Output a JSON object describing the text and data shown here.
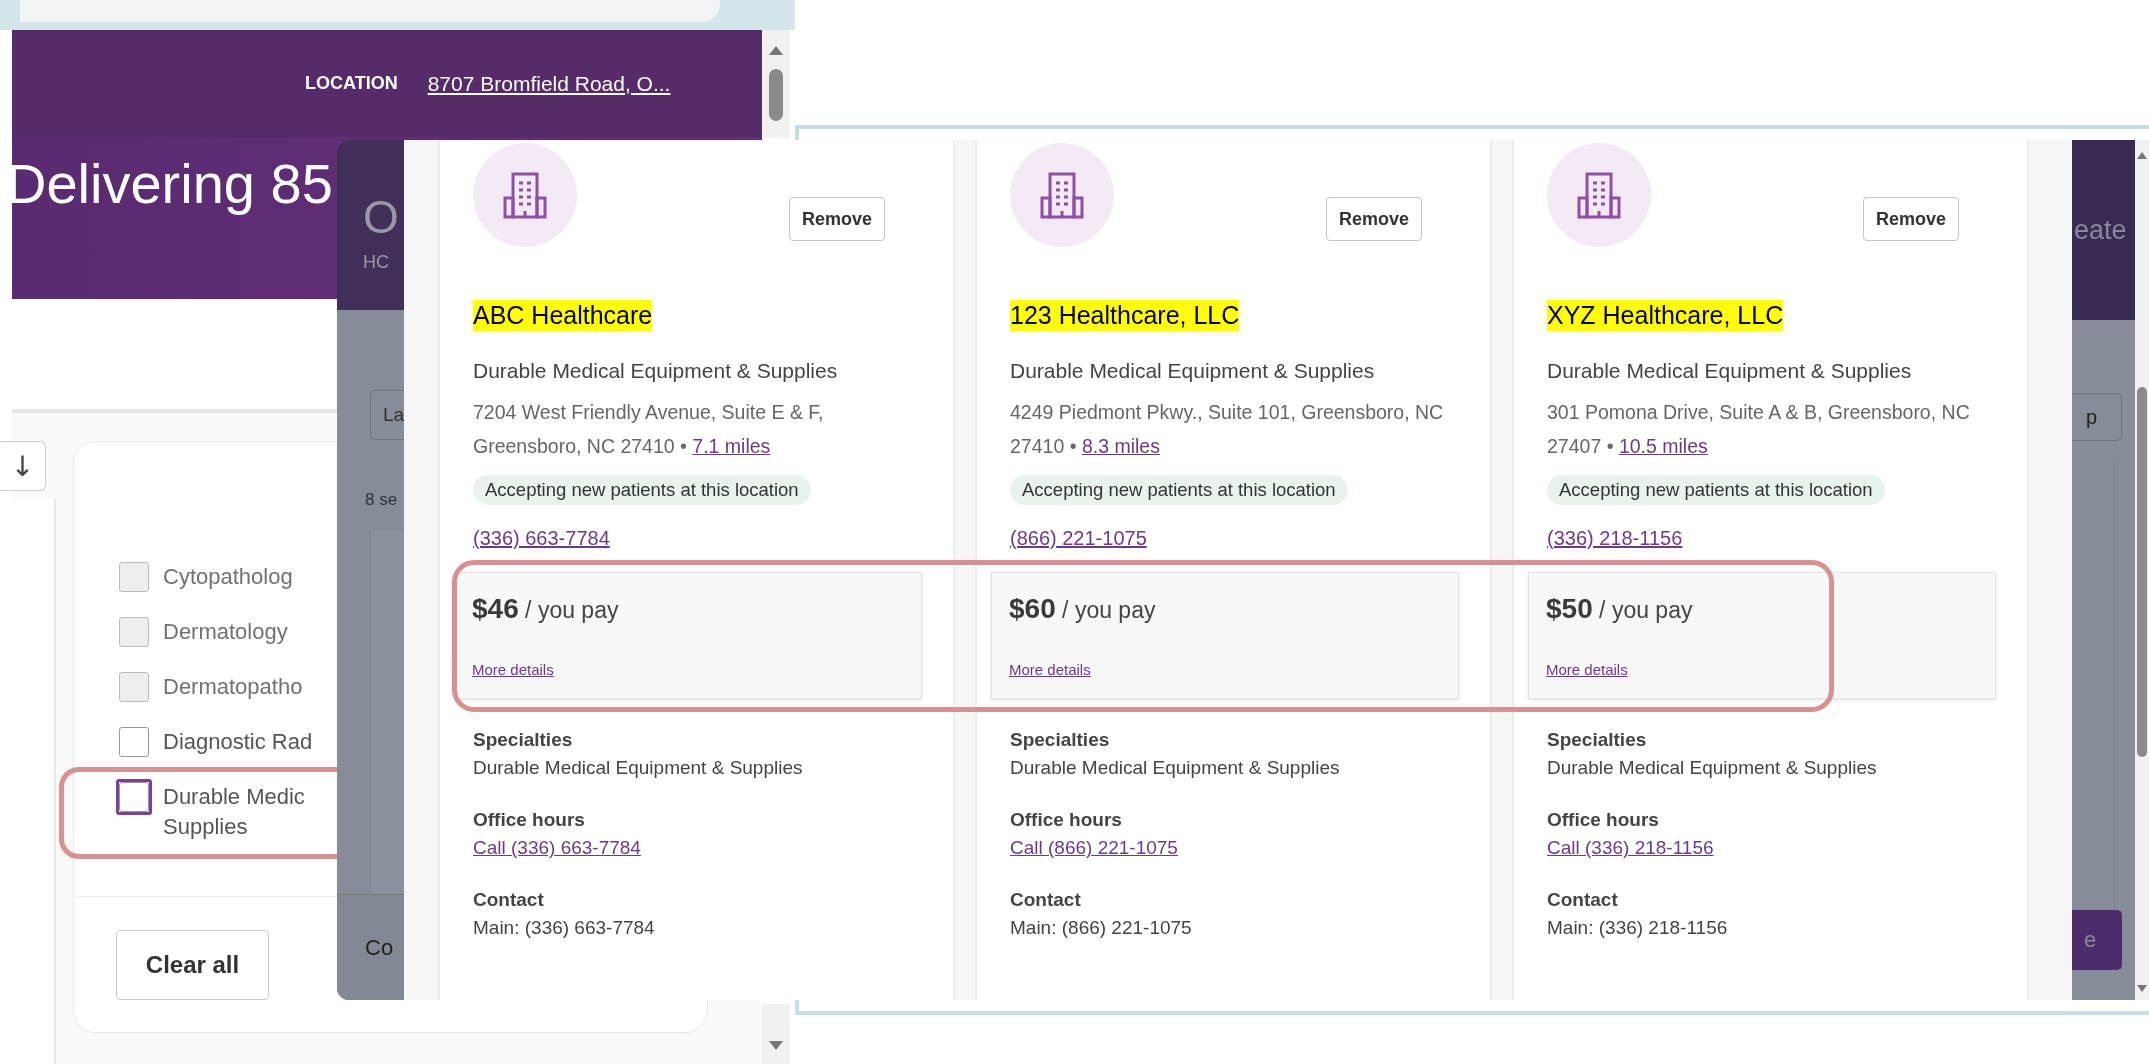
{
  "back_page": {
    "location_label": "LOCATION",
    "location": "8707 Bromfield Road, O...",
    "hero_title": "Delivering 85",
    "sort_button": "↓",
    "filters": [
      {
        "label": "Cytopatholog",
        "disabled": true,
        "focused": false
      },
      {
        "label": "Dermatology",
        "disabled": true,
        "focused": false
      },
      {
        "label": "Dermatopatho",
        "disabled": true,
        "focused": false
      },
      {
        "label": "Diagnostic Rad",
        "disabled": false,
        "focused": false
      },
      {
        "label": "Durable Medic Supplies",
        "disabled": false,
        "focused": true
      }
    ],
    "clear_button": "Clear all"
  },
  "dimmed_page": {
    "left": {
      "heading": "O",
      "subheading": "HC",
      "button": "La",
      "count": "8 se",
      "footer": "Co"
    },
    "right": {
      "heading": "eate",
      "button": "p",
      "action": "e"
    }
  },
  "compare_cards": [
    {
      "name": "ABC Healthcare",
      "remove": "Remove",
      "category": "Durable Medical Equipment & Supplies",
      "address": "7204 West Friendly Avenue, Suite E & F, Greensboro, NC 27410",
      "separator": "•",
      "distance": "7.1 miles",
      "badge": "Accepting new patients at this location",
      "phone": "(336) 663-7784",
      "price": "$46",
      "price_suffix": "/ you pay",
      "details_link": "More details",
      "sections": [
        {
          "title": "Specialties",
          "kind": "text",
          "value": "Durable Medical Equipment & Supplies"
        },
        {
          "title": "Office hours",
          "kind": "link",
          "value": "Call (336) 663-7784"
        },
        {
          "title": "Contact",
          "kind": "text",
          "value": "Main: (336) 663-7784"
        }
      ]
    },
    {
      "name": "123 Healthcare, LLC",
      "remove": "Remove",
      "category": "Durable Medical Equipment & Supplies",
      "address": "4249 Piedmont Pkwy., Suite 101, Greensboro, NC 27410",
      "separator": "•",
      "distance": "8.3 miles",
      "badge": "Accepting new patients at this location",
      "phone": "(866) 221-1075",
      "price": "$60",
      "price_suffix": "/ you pay",
      "details_link": "More details",
      "sections": [
        {
          "title": "Specialties",
          "kind": "text",
          "value": "Durable Medical Equipment & Supplies"
        },
        {
          "title": "Office hours",
          "kind": "link",
          "value": "Call (866) 221-1075"
        },
        {
          "title": "Contact",
          "kind": "text",
          "value": "Main: (866) 221-1075"
        }
      ]
    },
    {
      "name": "XYZ Healthcare, LLC",
      "remove": "Remove",
      "category": "Durable Medical Equipment & Supplies",
      "address": "301 Pomona Drive, Suite A & B, Greensboro, NC 27407",
      "separator": "•",
      "distance": "10.5 miles",
      "badge": "Accepting new patients at this location",
      "phone": "(336) 218-1156",
      "price": "$50",
      "price_suffix": "/ you pay",
      "details_link": "More details",
      "sections": [
        {
          "title": "Specialties",
          "kind": "text",
          "value": "Durable Medical Equipment & Supplies"
        },
        {
          "title": "Office hours",
          "kind": "link",
          "value": "Call (336) 218-1156"
        },
        {
          "title": "Contact",
          "kind": "text",
          "value": "Main: (336) 218-1156"
        }
      ]
    }
  ]
}
